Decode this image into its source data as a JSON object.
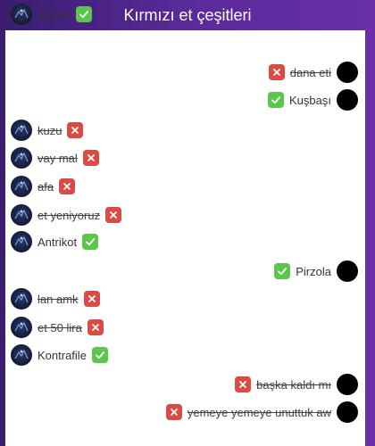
{
  "header": {
    "title": "Kırmızı et çeşitleri"
  },
  "colors": {
    "ok": "#5cc54c",
    "no": "#d94b44",
    "header_text": "#ffffff"
  },
  "messages": [
    {
      "text": "Kıyma",
      "side": "left",
      "status": "ok",
      "struck": false
    },
    {
      "text": "dana eti",
      "side": "right",
      "status": "no",
      "struck": true
    },
    {
      "text": "Kuşbaşı",
      "side": "right",
      "status": "ok",
      "struck": false
    },
    {
      "text": "kuzu",
      "side": "left",
      "status": "no",
      "struck": true
    },
    {
      "text": "vay mal",
      "side": "left",
      "status": "no",
      "struck": true
    },
    {
      "text": "afa",
      "side": "left",
      "status": "no",
      "struck": true
    },
    {
      "text": "et yeniyoruz",
      "side": "left",
      "status": "no",
      "struck": true
    },
    {
      "text": "Antrikot",
      "side": "left",
      "status": "ok",
      "struck": false
    },
    {
      "text": "Pirzola",
      "side": "right",
      "status": "ok",
      "struck": false
    },
    {
      "text": "lan amk",
      "side": "left",
      "status": "no",
      "struck": true
    },
    {
      "text": "et 50 lira",
      "side": "left",
      "status": "no",
      "struck": true
    },
    {
      "text": "Kontrafile",
      "side": "left",
      "status": "ok",
      "struck": false
    },
    {
      "text": "başka kaldı mı",
      "side": "right",
      "status": "no",
      "struck": true
    },
    {
      "text": "yemeye yemeye unuttuk aw",
      "side": "right",
      "status": "no",
      "struck": true
    }
  ]
}
